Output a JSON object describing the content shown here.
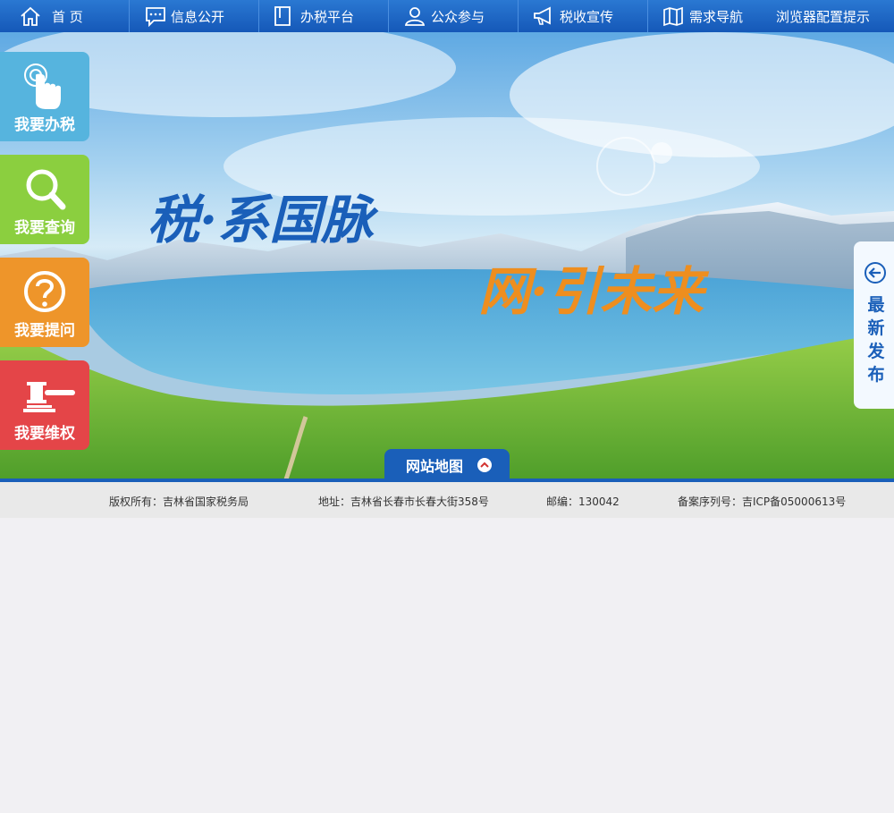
{
  "nav": {
    "home": "首 页",
    "info": "信息公开",
    "tax_platform": "办税平台",
    "public": "公众参与",
    "promo": "税收宣传",
    "demand": "需求导航",
    "browser": "浏览器配置提示"
  },
  "banner": {
    "slogan1": "税·系国脉",
    "slogan2": "网·引未来"
  },
  "side": {
    "do_tax": "我要办税",
    "query": "我要查询",
    "ask": "我要提问",
    "rights": "我要维权"
  },
  "latest": "最新发布",
  "sitemap": "网站地图",
  "footer": {
    "copyright": "版权所有：吉林省国家税务局",
    "address": "地址：吉林省长春市长春大街358号",
    "postcode": "邮编：130042",
    "icp": "备案序列号：吉ICP备05000613号"
  },
  "colors": {
    "nav": "#1558b8",
    "do_tax": "#56b4de",
    "query": "#8bcf3f",
    "ask": "#ee952a",
    "rights": "#e44548"
  }
}
